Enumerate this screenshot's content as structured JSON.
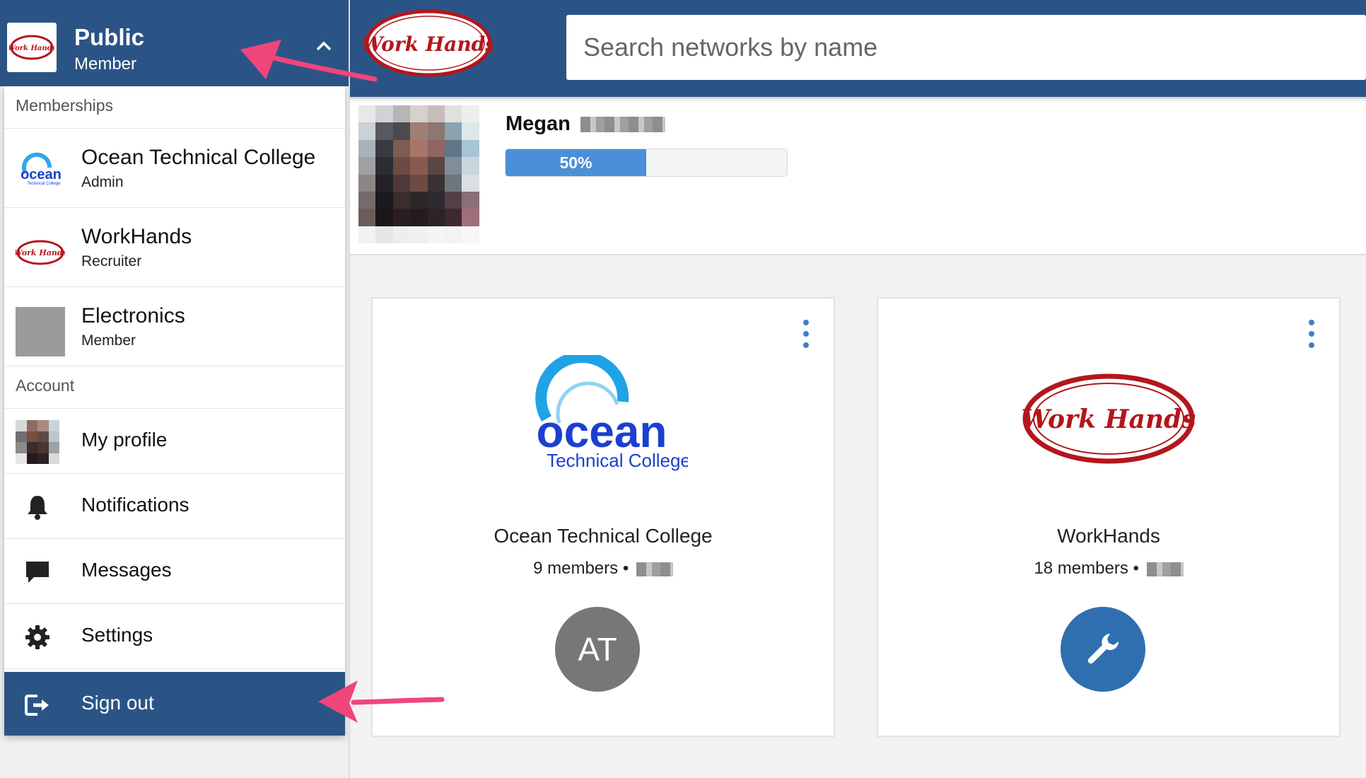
{
  "user_header": {
    "title": "Public",
    "subtitle": "Member"
  },
  "menu": {
    "memberships_heading": "Memberships",
    "memberships": [
      {
        "name": "Ocean Technical College",
        "role": "Admin"
      },
      {
        "name": "WorkHands",
        "role": "Recruiter"
      },
      {
        "name": "Electronics",
        "role": "Member"
      }
    ],
    "account_heading": "Account",
    "account_items": [
      {
        "label": "My profile",
        "icon": "avatar"
      },
      {
        "label": "Notifications",
        "icon": "bell-icon"
      },
      {
        "label": "Messages",
        "icon": "chat-bubble-icon"
      },
      {
        "label": "Settings",
        "icon": "gear-icon"
      },
      {
        "label": "Sign out",
        "icon": "sign-out-icon"
      }
    ]
  },
  "brand": {
    "logo_text": "Work Hands"
  },
  "search": {
    "placeholder": "Search networks by name"
  },
  "profile": {
    "name": "Megan",
    "progress_percent": 50,
    "progress_label": "50%"
  },
  "networks": [
    {
      "name": "Ocean Technical College",
      "members": "9 members •",
      "badge": "AT",
      "badge_color": "#777777",
      "logo_word": "ocean",
      "logo_sub": "Technical College"
    },
    {
      "name": "WorkHands",
      "members": "18 members •",
      "badge_icon": "wrench-icon",
      "badge_color": "#2f6fb0",
      "logo_text": "Work Hands"
    }
  ],
  "colors": {
    "primary": "#2b5486",
    "accent": "#4a8fd8",
    "annotation": "#f0457b"
  }
}
